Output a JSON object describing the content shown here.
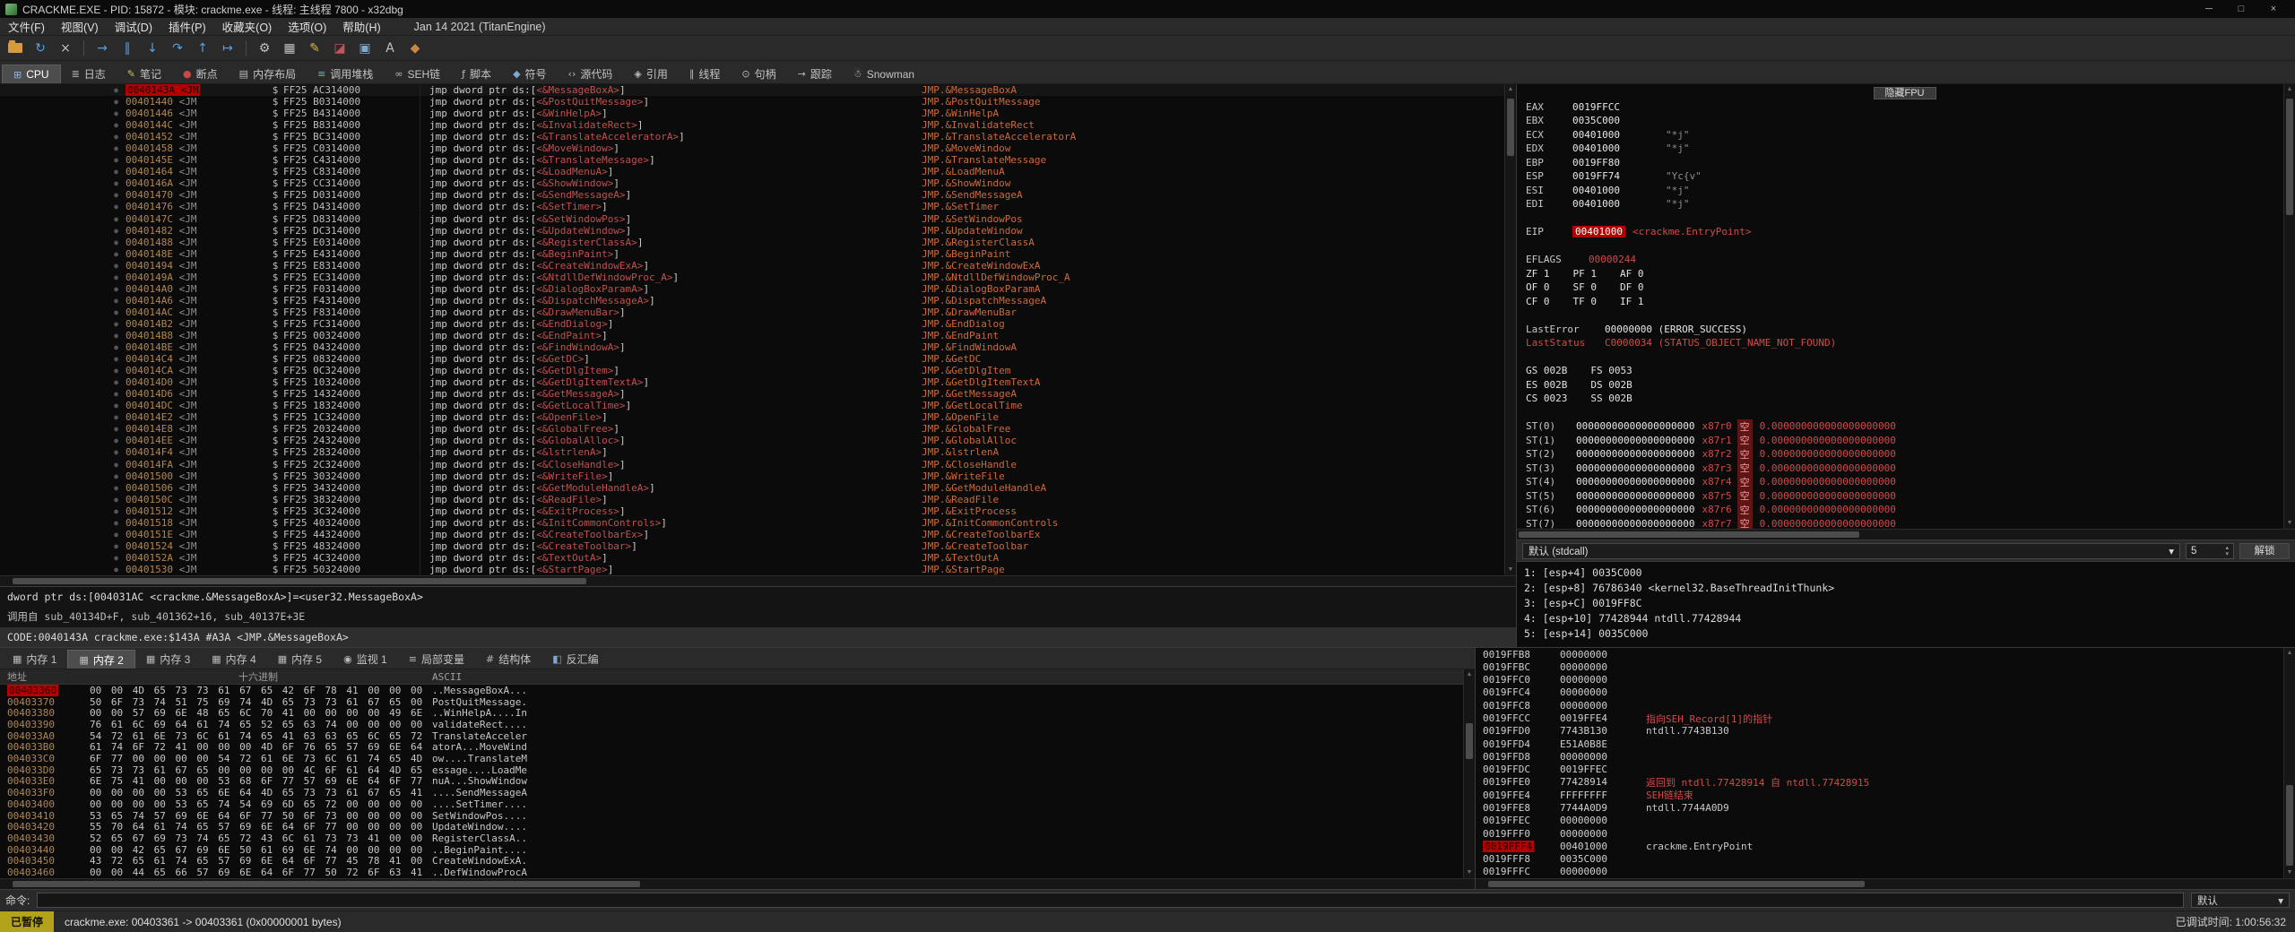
{
  "window": {
    "title": "CRACKME.EXE - PID: 15872 - 模块: crackme.exe - 线程: 主线程 7800 - x32dbg",
    "controls": {
      "minimize": "─",
      "maximize": "□",
      "close": "×"
    }
  },
  "ui": {
    "dropdown_arrow": "▾",
    "spin_up": "▴",
    "spin_down": "▾"
  },
  "scrollbar": {
    "up": "▲",
    "down": "▼"
  },
  "menu": {
    "items": [
      "文件(F)",
      "视图(V)",
      "调试(D)",
      "插件(P)",
      "收藏夹(O)",
      "选项(O)",
      "帮助(H)"
    ],
    "build_info": "Jan 14 2021 (TitanEngine)"
  },
  "toolbar": {
    "buttons": [
      {
        "name": "open-file",
        "type": "folder",
        "color": "#d79b3f"
      },
      {
        "name": "restart",
        "glyph": "↻",
        "color": "#57a0e8"
      },
      {
        "name": "close-process",
        "glyph": "×",
        "color": "#c2c2c2"
      },
      {
        "sep": true
      },
      {
        "name": "run",
        "glyph": "→",
        "color": "#57a0e8"
      },
      {
        "name": "pause",
        "glyph": "∥",
        "color": "#57a0e8"
      },
      {
        "name": "step-into",
        "glyph": "↓",
        "color": "#57a0e8"
      },
      {
        "name": "step-over",
        "glyph": "↷",
        "color": "#57a0e8"
      },
      {
        "name": "step-out",
        "glyph": "↑",
        "color": "#57a0e8"
      },
      {
        "name": "run-to-user-code",
        "glyph": "↦",
        "color": "#57a0e8"
      },
      {
        "sep": true
      },
      {
        "name": "settings-gear",
        "glyph": "⚙",
        "color": "#c2c2c2"
      },
      {
        "name": "calculator",
        "glyph": "▦",
        "color": "#c2c2c2"
      },
      {
        "name": "notes-pencil",
        "glyph": "✎",
        "color": "#d6b84a"
      },
      {
        "name": "patches",
        "glyph": "◪",
        "color": "#c25555"
      },
      {
        "name": "memory-chip",
        "glyph": "▣",
        "color": "#7fa8d0"
      },
      {
        "name": "font-size",
        "glyph": "A",
        "color": "#c2c2c2"
      },
      {
        "name": "theme",
        "glyph": "◆",
        "color": "#c9863f"
      }
    ]
  },
  "main_tabs": {
    "items": [
      {
        "name": "cpu",
        "label": "CPU",
        "glyph": "⊞",
        "color": "#8fb6dd",
        "selected": true
      },
      {
        "name": "log",
        "label": "日志",
        "glyph": "≣",
        "color": "#b9b9b9"
      },
      {
        "name": "notes",
        "label": "笔记",
        "glyph": "✎",
        "color": "#d0bd62"
      },
      {
        "name": "breakpoints",
        "label": "断点",
        "glyph": "●",
        "color": "#c84848"
      },
      {
        "name": "memory-map",
        "label": "内存布局",
        "glyph": "▤",
        "color": "#b9b9b9"
      },
      {
        "name": "call-stack",
        "label": "调用堆栈",
        "glyph": "≡",
        "color": "#7fa8d0"
      },
      {
        "name": "seh-chain",
        "label": "SEH链",
        "glyph": "∞",
        "color": "#b9b9b9"
      },
      {
        "name": "script",
        "label": "脚本",
        "glyph": "ƒ",
        "color": "#b9b9b9"
      },
      {
        "name": "symbols",
        "label": "符号",
        "glyph": "◆",
        "color": "#7fa8d0"
      },
      {
        "name": "source",
        "label": "源代码",
        "glyph": "‹›",
        "color": "#b9b9b9"
      },
      {
        "name": "references",
        "label": "引用",
        "glyph": "◈",
        "color": "#b9b9b9"
      },
      {
        "name": "threads",
        "label": "线程",
        "glyph": "∥",
        "color": "#b9b9b9"
      },
      {
        "name": "handles",
        "label": "句柄",
        "glyph": "⊙",
        "color": "#b9b9b9"
      },
      {
        "name": "trace",
        "label": "跟踪",
        "glyph": "→",
        "color": "#b9b9b9"
      },
      {
        "name": "snowman",
        "label": "Snowman",
        "glyph": "☃",
        "color": "#cfcfcf"
      }
    ]
  },
  "disasm": {
    "selected_addr": "0040143A",
    "addr_label": "<JM",
    "marker": "$",
    "instr_prefix": "jmp dword ptr ds:[",
    "api_open": "<&",
    "api_close": ">",
    "instr_suffix": "]",
    "comment_prefix": "JMP.&",
    "rows": [
      {
        "addr": "0040143A",
        "bytes": "FF25 AC314000",
        "api": "MessageBoxA"
      },
      {
        "addr": "00401440",
        "bytes": "FF25 B0314000",
        "api": "PostQuitMessage"
      },
      {
        "addr": "00401446",
        "bytes": "FF25 B4314000",
        "api": "WinHelpA"
      },
      {
        "addr": "0040144C",
        "bytes": "FF25 B8314000",
        "api": "InvalidateRect"
      },
      {
        "addr": "00401452",
        "bytes": "FF25 BC314000",
        "api": "TranslateAcceleratorA"
      },
      {
        "addr": "00401458",
        "bytes": "FF25 C0314000",
        "api": "MoveWindow"
      },
      {
        "addr": "0040145E",
        "bytes": "FF25 C4314000",
        "api": "TranslateMessage"
      },
      {
        "addr": "00401464",
        "bytes": "FF25 C8314000",
        "api": "LoadMenuA"
      },
      {
        "addr": "0040146A",
        "bytes": "FF25 CC314000",
        "api": "ShowWindow"
      },
      {
        "addr": "00401470",
        "bytes": "FF25 D0314000",
        "api": "SendMessageA"
      },
      {
        "addr": "00401476",
        "bytes": "FF25 D4314000",
        "api": "SetTimer"
      },
      {
        "addr": "0040147C",
        "bytes": "FF25 D8314000",
        "api": "SetWindowPos"
      },
      {
        "addr": "00401482",
        "bytes": "FF25 DC314000",
        "api": "UpdateWindow"
      },
      {
        "addr": "00401488",
        "bytes": "FF25 E0314000",
        "api": "RegisterClassA"
      },
      {
        "addr": "0040148E",
        "bytes": "FF25 E4314000",
        "api": "BeginPaint"
      },
      {
        "addr": "00401494",
        "bytes": "FF25 E8314000",
        "api": "CreateWindowExA"
      },
      {
        "addr": "0040149A",
        "bytes": "FF25 EC314000",
        "api": "NtdllDefWindowProc_A"
      },
      {
        "addr": "004014A0",
        "bytes": "FF25 F0314000",
        "api": "DialogBoxParamA"
      },
      {
        "addr": "004014A6",
        "bytes": "FF25 F4314000",
        "api": "DispatchMessageA"
      },
      {
        "addr": "004014AC",
        "bytes": "FF25 F8314000",
        "api": "DrawMenuBar"
      },
      {
        "addr": "004014B2",
        "bytes": "FF25 FC314000",
        "api": "EndDialog"
      },
      {
        "addr": "004014B8",
        "bytes": "FF25 00324000",
        "api": "EndPaint"
      },
      {
        "addr": "004014BE",
        "bytes": "FF25 04324000",
        "api": "FindWindowA"
      },
      {
        "addr": "004014C4",
        "bytes": "FF25 08324000",
        "api": "GetDC"
      },
      {
        "addr": "004014CA",
        "bytes": "FF25 0C324000",
        "api": "GetDlgItem"
      },
      {
        "addr": "004014D0",
        "bytes": "FF25 10324000",
        "api": "GetDlgItemTextA"
      },
      {
        "addr": "004014D6",
        "bytes": "FF25 14324000",
        "api": "GetMessageA"
      },
      {
        "addr": "004014DC",
        "bytes": "FF25 18324000",
        "api": "GetLocalTime"
      },
      {
        "addr": "004014E2",
        "bytes": "FF25 1C324000",
        "api": "OpenFile"
      },
      {
        "addr": "004014E8",
        "bytes": "FF25 20324000",
        "api": "GlobalFree"
      },
      {
        "addr": "004014EE",
        "bytes": "FF25 24324000",
        "api": "GlobalAlloc"
      },
      {
        "addr": "004014F4",
        "bytes": "FF25 28324000",
        "api": "lstrlenA"
      },
      {
        "addr": "004014FA",
        "bytes": "FF25 2C324000",
        "api": "CloseHandle"
      },
      {
        "addr": "00401500",
        "bytes": "FF25 30324000",
        "api": "WriteFile"
      },
      {
        "addr": "00401506",
        "bytes": "FF25 34324000",
        "api": "GetModuleHandleA"
      },
      {
        "addr": "0040150C",
        "bytes": "FF25 38324000",
        "api": "ReadFile"
      },
      {
        "addr": "00401512",
        "bytes": "FF25 3C324000",
        "api": "ExitProcess"
      },
      {
        "addr": "00401518",
        "bytes": "FF25 40324000",
        "api": "InitCommonControls"
      },
      {
        "addr": "0040151E",
        "bytes": "FF25 44324000",
        "api": "CreateToolbarEx"
      },
      {
        "addr": "00401524",
        "bytes": "FF25 48324000",
        "api": "CreateToolbar"
      },
      {
        "addr": "0040152A",
        "bytes": "FF25 4C324000",
        "api": "TextOutA"
      },
      {
        "addr": "00401530",
        "bytes": "FF25 50324000",
        "api": "StartPage"
      }
    ]
  },
  "info_pane": {
    "line1": "dword ptr ds:[004031AC <crackme.&MessageBoxA>]=<user32.MessageBoxA>",
    "line2": "调用自 sub_40134D+F, sub_401362+16, sub_40137E+3E",
    "line3": "CODE:0040143A crackme.exe:$143A #A3A <JMP.&MessageBoxA>"
  },
  "registers": {
    "hide_fpu": "隐藏FPU",
    "gpr": [
      {
        "name": "EAX",
        "value": "0019FFCC",
        "extra": ""
      },
      {
        "name": "EBX",
        "value": "0035C000",
        "extra": ""
      },
      {
        "name": "ECX",
        "value": "00401000",
        "extra": "\"*j\""
      },
      {
        "name": "EDX",
        "value": "00401000",
        "extra": "\"*j\""
      },
      {
        "name": "EBP",
        "value": "0019FF80",
        "extra": ""
      },
      {
        "name": "ESP",
        "value": "0019FF74",
        "extra": "\"Yc{v\""
      },
      {
        "name": "ESI",
        "value": "00401000",
        "extra": "\"*j\""
      },
      {
        "name": "EDI",
        "value": "00401000",
        "extra": "\"*j\""
      }
    ],
    "eip": {
      "name": "EIP",
      "value": "00401000",
      "label": "<crackme.EntryPoint>"
    },
    "eflags": {
      "name": "EFLAGS",
      "value": "00000244"
    },
    "flags": [
      [
        "ZF",
        "1"
      ],
      [
        "PF",
        "1"
      ],
      [
        "AF",
        "0"
      ],
      [
        "OF",
        "0"
      ],
      [
        "SF",
        "0"
      ],
      [
        "DF",
        "0"
      ],
      [
        "CF",
        "0"
      ],
      [
        "TF",
        "0"
      ],
      [
        "IF",
        "1"
      ]
    ],
    "last_error": {
      "name": "LastError",
      "value": "00000000 (ERROR_SUCCESS)"
    },
    "last_status": {
      "name": "LastStatus",
      "value": "C0000034 (STATUS_OBJECT_NAME_NOT_FOUND)"
    },
    "segments": [
      [
        "GS",
        "002B"
      ],
      [
        "FS",
        "0053"
      ],
      [
        "ES",
        "002B"
      ],
      [
        "DS",
        "002B"
      ],
      [
        "CS",
        "0023"
      ],
      [
        "SS",
        "002B"
      ]
    ],
    "st_zeros": "00000000000000000000",
    "st_tag": "空",
    "st_value": "0.000000000000000000000",
    "st": [
      {
        "name": "ST(0)",
        "reg": "x87r0"
      },
      {
        "name": "ST(1)",
        "reg": "x87r1"
      },
      {
        "name": "ST(2)",
        "reg": "x87r2"
      },
      {
        "name": "ST(3)",
        "reg": "x87r3"
      },
      {
        "name": "ST(4)",
        "reg": "x87r4"
      },
      {
        "name": "ST(5)",
        "reg": "x87r5"
      },
      {
        "name": "ST(6)",
        "reg": "x87r6"
      },
      {
        "name": "ST(7)",
        "reg": "x87r7"
      }
    ]
  },
  "callconv": {
    "label": "默认 (stdcall)",
    "count": "5",
    "unlock": "解锁"
  },
  "args": {
    "rows": [
      "1: [esp+4] 0035C000",
      "2: [esp+8] 76786340 <kernel32.BaseThreadInitThunk>",
      "3: [esp+C] 0019FF8C",
      "4: [esp+10] 77428944 ntdll.77428944",
      "5: [esp+14] 0035C000"
    ]
  },
  "bottom_tabs": {
    "items": [
      {
        "name": "dump-1",
        "label": "内存 1",
        "glyph": "▦",
        "color": "#b9b9b9"
      },
      {
        "name": "dump-2",
        "label": "内存 2",
        "glyph": "▦",
        "color": "#b9b9b9",
        "selected": true
      },
      {
        "name": "dump-3",
        "label": "内存 3",
        "glyph": "▦",
        "color": "#b9b9b9"
      },
      {
        "name": "dump-4",
        "label": "内存 4",
        "glyph": "▦",
        "color": "#b9b9b9"
      },
      {
        "name": "dump-5",
        "label": "内存 5",
        "glyph": "▦",
        "color": "#b9b9b9"
      },
      {
        "name": "watch-1",
        "label": "监视 1",
        "glyph": "◉",
        "color": "#b9b9b9"
      },
      {
        "name": "locals",
        "label": "局部变量",
        "glyph": "≡",
        "color": "#b9b9b9"
      },
      {
        "name": "struct",
        "label": "结构体",
        "glyph": "#",
        "color": "#b9b9b9"
      },
      {
        "name": "disassembly",
        "label": "反汇编",
        "glyph": "◧",
        "color": "#7fa8d0"
      }
    ]
  },
  "dump": {
    "headers": {
      "addr": "地址",
      "hex": "十六进制",
      "ascii": "ASCII"
    },
    "selected_addr": "00403360",
    "rows": [
      {
        "addr": "00403360",
        "hex": "00 00 4D 65 73 73 61 67 65 42 6F 78 41 00 00 00",
        "ascii": "..MessageBoxA..."
      },
      {
        "addr": "00403370",
        "hex": "50 6F 73 74 51 75 69 74 4D 65 73 73 61 67 65 00",
        "ascii": "PostQuitMessage."
      },
      {
        "addr": "00403380",
        "hex": "00 00 57 69 6E 48 65 6C 70 41 00 00 00 00 49 6E",
        "ascii": "..WinHelpA....In"
      },
      {
        "addr": "00403390",
        "hex": "76 61 6C 69 64 61 74 65 52 65 63 74 00 00 00 00",
        "ascii": "validateRect...."
      },
      {
        "addr": "004033A0",
        "hex": "54 72 61 6E 73 6C 61 74 65 41 63 63 65 6C 65 72",
        "ascii": "TranslateAcceler"
      },
      {
        "addr": "004033B0",
        "hex": "61 74 6F 72 41 00 00 00 4D 6F 76 65 57 69 6E 64",
        "ascii": "atorA...MoveWind"
      },
      {
        "addr": "004033C0",
        "hex": "6F 77 00 00 00 00 54 72 61 6E 73 6C 61 74 65 4D",
        "ascii": "ow....TranslateM"
      },
      {
        "addr": "004033D0",
        "hex": "65 73 73 61 67 65 00 00 00 00 4C 6F 61 64 4D 65",
        "ascii": "essage....LoadMe"
      },
      {
        "addr": "004033E0",
        "hex": "6E 75 41 00 00 00 53 68 6F 77 57 69 6E 64 6F 77",
        "ascii": "nuA...ShowWindow"
      },
      {
        "addr": "004033F0",
        "hex": "00 00 00 00 53 65 6E 64 4D 65 73 73 61 67 65 41",
        "ascii": "....SendMessageA"
      },
      {
        "addr": "00403400",
        "hex": "00 00 00 00 53 65 74 54 69 6D 65 72 00 00 00 00",
        "ascii": "....SetTimer...."
      },
      {
        "addr": "00403410",
        "hex": "53 65 74 57 69 6E 64 6F 77 50 6F 73 00 00 00 00",
        "ascii": "SetWindowPos...."
      },
      {
        "addr": "00403420",
        "hex": "55 70 64 61 74 65 57 69 6E 64 6F 77 00 00 00 00",
        "ascii": "UpdateWindow...."
      },
      {
        "addr": "00403430",
        "hex": "52 65 67 69 73 74 65 72 43 6C 61 73 73 41 00 00",
        "ascii": "RegisterClassA.."
      },
      {
        "addr": "00403440",
        "hex": "00 00 42 65 67 69 6E 50 61 69 6E 74 00 00 00 00",
        "ascii": "..BeginPaint...."
      },
      {
        "addr": "00403450",
        "hex": "43 72 65 61 74 65 57 69 6E 64 6F 77 45 78 41 00",
        "ascii": "CreateWindowExA."
      },
      {
        "addr": "00403460",
        "hex": "00 00 44 65 66 57 69 6E 64 6F 77 50 72 6F 63 41",
        "ascii": "..DefWindowProcA"
      }
    ]
  },
  "stack": {
    "selected_addr": "0019FFF4",
    "rows": [
      {
        "addr": "0019FFB8",
        "value": "00000000",
        "comment": "",
        "red": false
      },
      {
        "addr": "0019FFBC",
        "value": "00000000",
        "comment": "",
        "red": false
      },
      {
        "addr": "0019FFC0",
        "value": "00000000",
        "comment": "",
        "red": false
      },
      {
        "addr": "0019FFC4",
        "value": "00000000",
        "comment": "",
        "red": false
      },
      {
        "addr": "0019FFC8",
        "value": "00000000",
        "comment": "",
        "red": false
      },
      {
        "addr": "0019FFCC",
        "value": "0019FFE4",
        "comment": "指向SEH_Record[1]的指针",
        "red": true
      },
      {
        "addr": "0019FFD0",
        "value": "7743B130",
        "comment": "ntdll.7743B130",
        "red": false
      },
      {
        "addr": "0019FFD4",
        "value": "E51A0B8E",
        "comment": "",
        "red": false
      },
      {
        "addr": "0019FFD8",
        "value": "00000000",
        "comment": "",
        "red": false
      },
      {
        "addr": "0019FFDC",
        "value": "0019FFEC",
        "comment": "",
        "red": false
      },
      {
        "addr": "0019FFE0",
        "value": "77428914",
        "comment": "返回到 ntdll.77428914 自 ntdll.77428915",
        "red": true
      },
      {
        "addr": "0019FFE4",
        "value": "FFFFFFFF",
        "comment": "SEH链结束",
        "red": true
      },
      {
        "addr": "0019FFE8",
        "value": "7744A0D9",
        "comment": "ntdll.7744A0D9",
        "red": false
      },
      {
        "addr": "0019FFEC",
        "value": "00000000",
        "comment": "",
        "red": false
      },
      {
        "addr": "0019FFF0",
        "value": "00000000",
        "comment": "",
        "red": false
      },
      {
        "addr": "0019FFF4",
        "value": "00401000",
        "comment": "crackme.EntryPoint",
        "red": false
      },
      {
        "addr": "0019FFF8",
        "value": "0035C000",
        "comment": "",
        "red": false
      },
      {
        "addr": "0019FFFC",
        "value": "00000000",
        "comment": "",
        "red": false
      }
    ]
  },
  "command": {
    "label": "命令:",
    "value": "",
    "right": "默认"
  },
  "status": {
    "state": "已暂停",
    "message": "crackme.exe: 00403361 -> 00403361 (0x00000001 bytes)",
    "time": "已调试时间: 1:00:56:32"
  }
}
